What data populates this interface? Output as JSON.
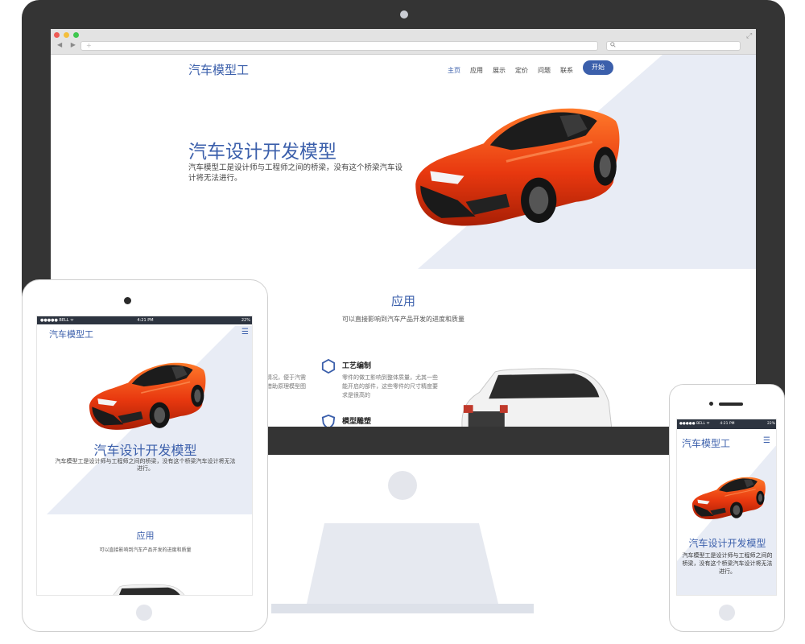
{
  "colors": {
    "brand": "#3b5fab",
    "frame": "#343434",
    "hero_shape": "#e8ecf5",
    "car": "#e8380f"
  },
  "desktop": {
    "browser": {
      "back_icon": "left-arrow-icon",
      "forward_icon": "right-arrow-icon",
      "new_tab": "+",
      "search_icon": "search-icon"
    },
    "brand": "汽车模型工",
    "nav": [
      "主页",
      "应用",
      "展示",
      "定价",
      "问题",
      "联系"
    ],
    "start_button": "开始",
    "hero": {
      "title": "汽车设计开发模型",
      "description": "汽车模型工是设计师与工程师之间的桥梁，没有这个桥梁汽车设计将无法进行。"
    },
    "section": {
      "title": "应用",
      "subtitle": "可以直接影响到汽车产品开发的进度和质量",
      "fragment_text": "情况，便于汽需借助原理模型图",
      "features": [
        {
          "icon": "hexagon-icon",
          "title": "工艺编制",
          "desc": "零件的做工影响到整体质量，尤其一些能开启的部件，这些零件的尺寸精度要求是很高的"
        },
        {
          "icon": "shield-icon",
          "title": "模型雕塑"
        }
      ]
    }
  },
  "tablet": {
    "status": {
      "carrier": "●●●●● BELL ᯤ",
      "time": "4:21 PM",
      "battery": "22%"
    },
    "brand": "汽车模型工",
    "menu_icon": "hamburger-menu-icon",
    "hero_title": "汽车设计开发模型",
    "hero_desc": "汽车模型工是设计师与工程师之间的桥梁，没有这个桥梁汽车设计将无法进行。",
    "section_title": "应用",
    "section_sub": "可以直接影响到汽车产品开发的进度和质量"
  },
  "phone": {
    "status": {
      "carrier": "●●●●● BELL ᯤ",
      "time": "4:21 PM",
      "battery": "22%"
    },
    "brand": "汽车模型工",
    "menu_icon": "hamburger-menu-icon",
    "hero_title": "汽车设计开发模型",
    "hero_desc": "汽车模型工是设计师与工程师之间的桥梁，没有这个桥梁汽车设计将无法进行。"
  }
}
